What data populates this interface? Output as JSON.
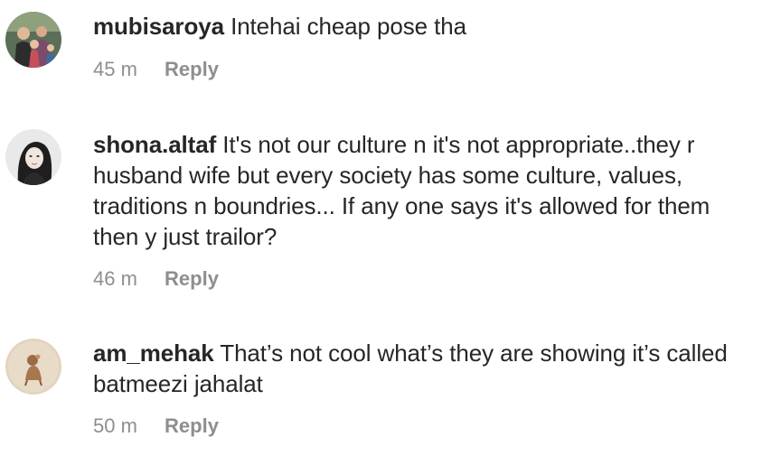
{
  "comments": [
    {
      "username": "mubisaroya",
      "text": "Intehai cheap pose tha",
      "time": "45 m",
      "reply_label": "Reply"
    },
    {
      "username": "shona.altaf",
      "text": "It's not our culture n it's not appropriate..they r husband wife but every society has some culture, values, traditions n boundries... If any one says it's allowed for them then y just trailor?",
      "time": "46 m",
      "reply_label": "Reply"
    },
    {
      "username": "am_mehak",
      "text": "That’s not cool what’s they are showing it’s called batmeezi jahalat",
      "time": "50 m",
      "reply_label": "Reply"
    }
  ]
}
